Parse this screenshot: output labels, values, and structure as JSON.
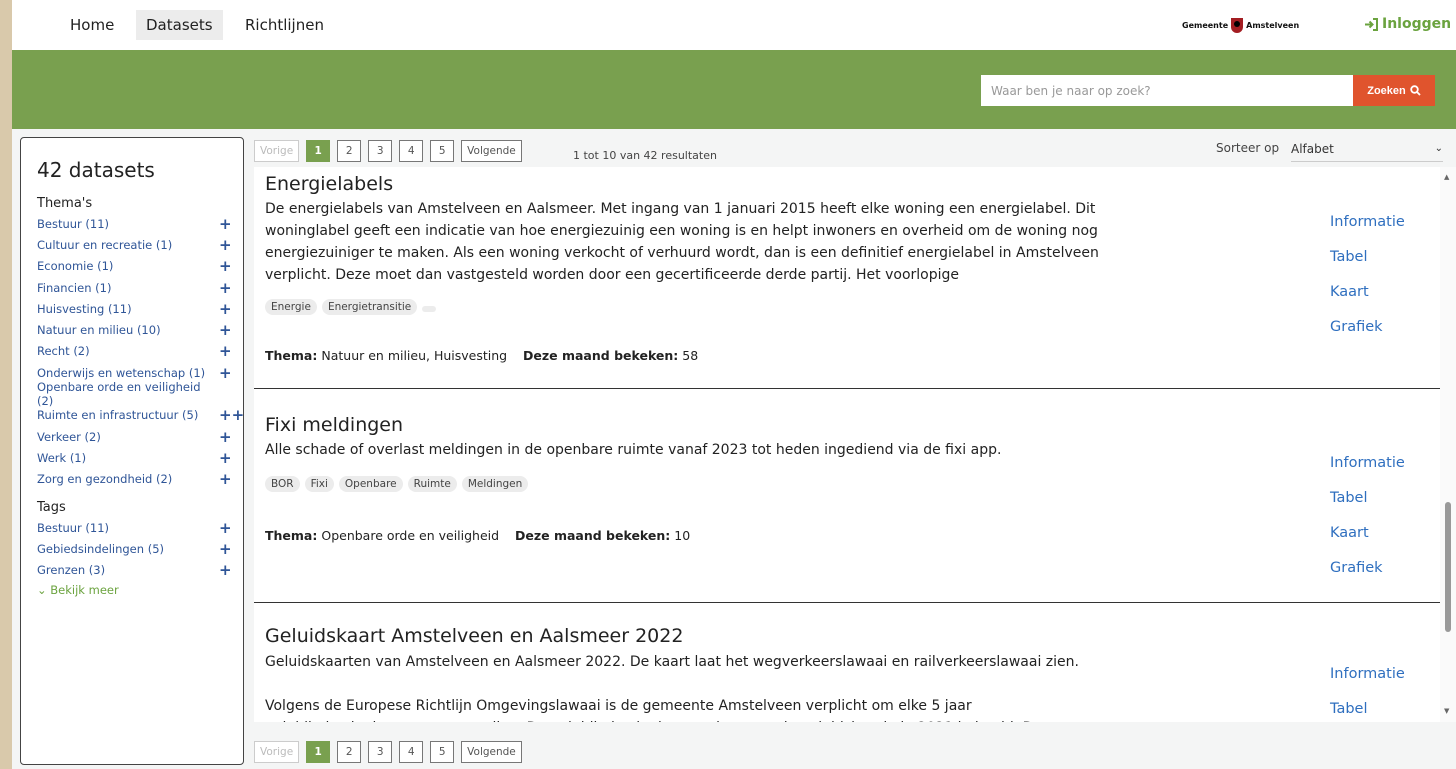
{
  "nav": {
    "items": [
      "Home",
      "Datasets",
      "Richtlijnen"
    ],
    "logo_text": "Gemeente",
    "logo_text2": "Amstelveen",
    "login": "Inloggen"
  },
  "search": {
    "placeholder": "Waar ben je naar op zoek?",
    "button": "Zoeken"
  },
  "sidebar": {
    "title": "42 datasets",
    "themes_title": "Thema's",
    "themes": [
      {
        "label": "Bestuur (11)",
        "plus": "+"
      },
      {
        "label": "Cultuur en recreatie (1)",
        "plus": "+"
      },
      {
        "label": "Economie (1)",
        "plus": "+"
      },
      {
        "label": "Financien (1)",
        "plus": "+"
      },
      {
        "label": "Huisvesting (11)",
        "plus": "+"
      },
      {
        "label": "Natuur en milieu (10)",
        "plus": "+"
      },
      {
        "label": "Recht (2)",
        "plus": "+"
      },
      {
        "label": "Onderwijs en wetenschap (1)",
        "plus": "+"
      },
      {
        "label": "Openbare orde en veiligheid (2)",
        "plus": ""
      },
      {
        "label": "Ruimte en infrastructuur (5)",
        "plus": "++"
      },
      {
        "label": "Verkeer (2)",
        "plus": "+"
      },
      {
        "label": "Werk (1)",
        "plus": "+"
      },
      {
        "label": "Zorg en gezondheid (2)",
        "plus": "+"
      }
    ],
    "tags_title": "Tags",
    "tags": [
      {
        "label": "Bestuur (11)",
        "plus": "+"
      },
      {
        "label": "Gebiedsindelingen (5)",
        "plus": "+"
      },
      {
        "label": "Grenzen (3)",
        "plus": "+"
      }
    ],
    "more": "Bekijk meer"
  },
  "pager": {
    "prev": "Vorige",
    "pages": [
      "1",
      "2",
      "3",
      "4",
      "5"
    ],
    "current": "1",
    "next": "Volgende",
    "info": "1 tot 10 van 42 resultaten"
  },
  "sort": {
    "label": "Sorteer op",
    "value": "Alfabet"
  },
  "results": [
    {
      "title": "Energielabels",
      "description": "De energielabels van Amstelveen en Aalsmeer. Met ingang van 1 januari 2015 heeft elke woning een energielabel. Dit woninglabel geeft een indicatie van hoe energiezuinig een woning is en helpt inwoners en overheid om de woning nog energiezuiniger te maken. Als een woning verkocht of verhuurd wordt, dan is een definitief energielabel in Amstelveen verplicht. Deze moet dan vastgesteld worden door een gecertificeerde derde partij. Het voorlopige",
      "tags": [
        "Energie",
        "Energietransitie"
      ],
      "theme_label": "Thema:",
      "theme": "Natuur en milieu, Huisvesting",
      "views_label": "Deze maand bekeken:",
      "views": "58"
    },
    {
      "title": "Fixi meldingen",
      "description": "Alle schade of overlast meldingen in de openbare ruimte vanaf 2023 tot heden ingediend via de fixi app.",
      "tags": [
        "BOR",
        "Fixi",
        "Openbare",
        "Ruimte",
        "Meldingen"
      ],
      "theme_label": "Thema:",
      "theme": "Openbare orde en veiligheid",
      "views_label": "Deze maand bekeken:",
      "views": "10"
    },
    {
      "title": "Geluidskaart Amstelveen en Aalsmeer 2022",
      "description": "Geluidskaarten van Amstelveen en Aalsmeer 2022. De kaart laat het wegverkeerslawaai en railverkeerslawaai zien.",
      "description2": "Volgens de Europese Richtlijn Omgevingslawaai is de gemeente Amstelveen verplicht om elke 5 jaar geluidbelastingkaarten op te stellen. De geluidbelastingkaarten brengen de geluidsituatie in 2021 in beeld. De"
    }
  ],
  "actions": [
    "Informatie",
    "Tabel",
    "Kaart",
    "Grafiek"
  ]
}
